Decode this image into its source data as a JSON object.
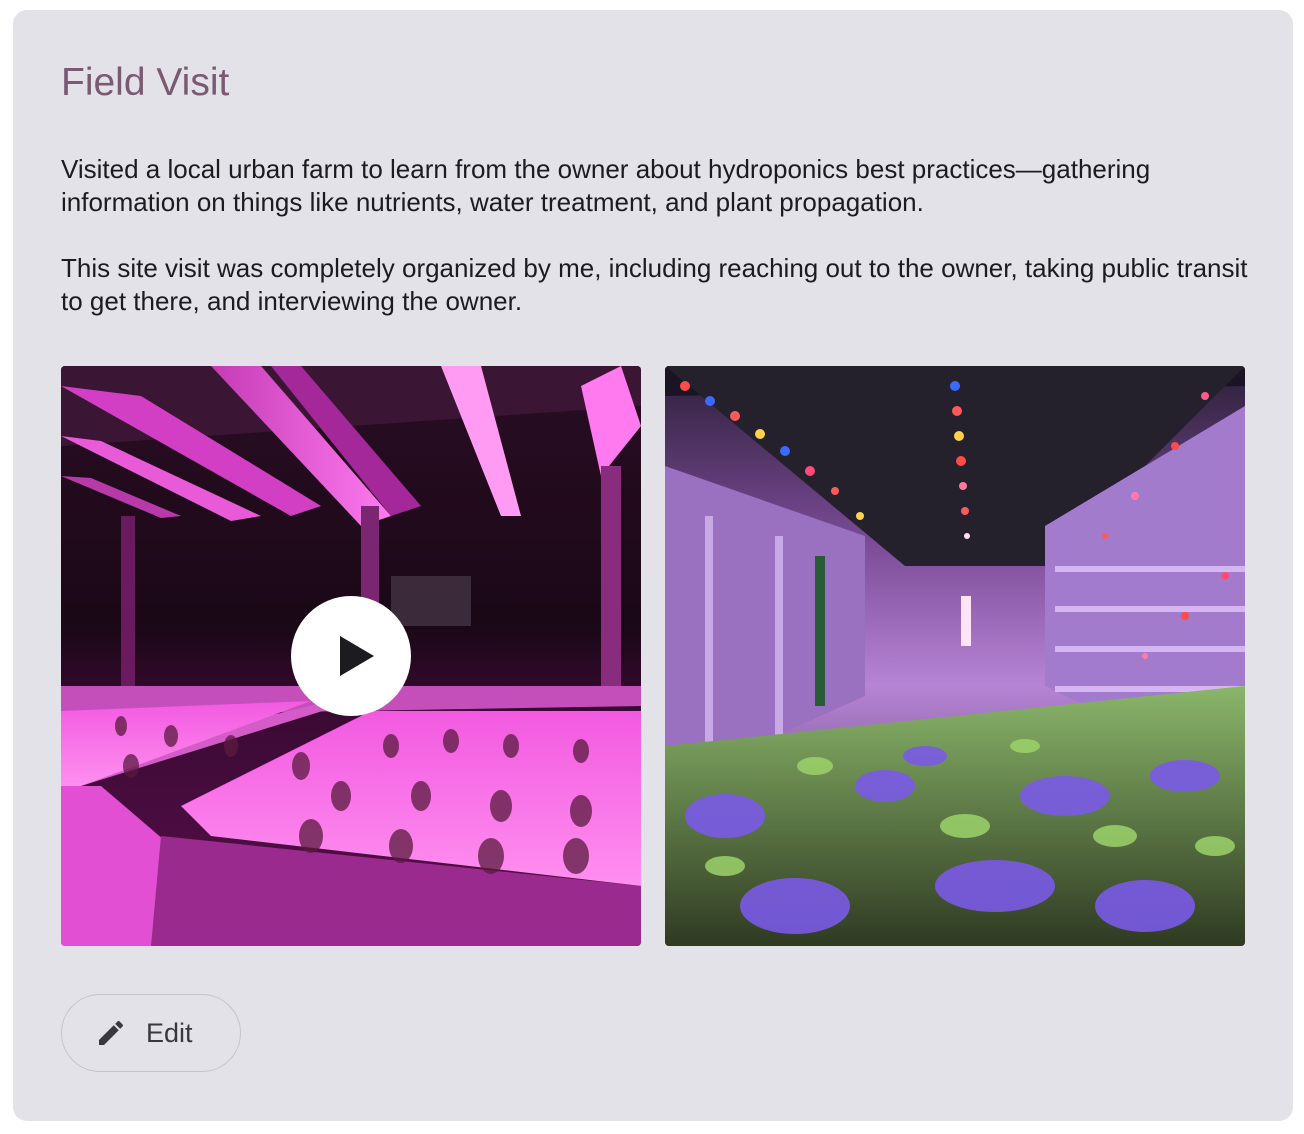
{
  "card": {
    "title": "Field Visit",
    "paragraphs": [
      "Visited a local urban farm to learn from the owner about hydroponics best practices—gathering information on things like nutrients, water treatment, and plant propagation.",
      "This site visit was completely organized by me, including reaching out to the owner, taking public transit to get there, and interviewing the owner."
    ],
    "media": [
      {
        "kind": "video",
        "icon": "play-icon"
      },
      {
        "kind": "image"
      }
    ],
    "edit_button": {
      "label": "Edit",
      "icon": "pencil-icon"
    }
  },
  "colors": {
    "card_background": "#e3e2e8",
    "title": "#7a5a72",
    "body_text": "#1c1b1f",
    "button_border": "#c6c3cb"
  }
}
